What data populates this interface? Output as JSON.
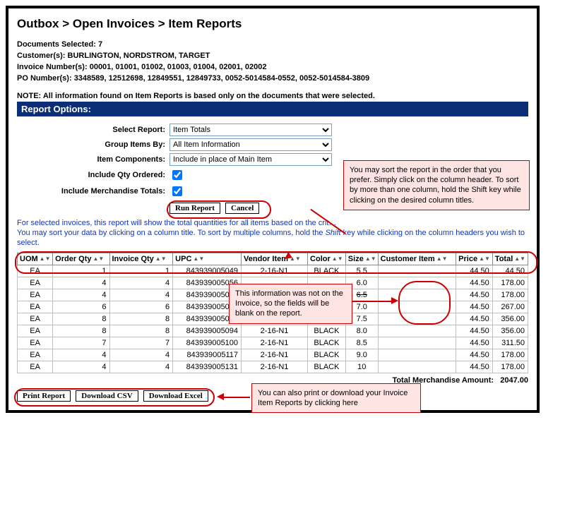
{
  "breadcrumb": "Outbox > Open Invoices > Item Reports",
  "summary": {
    "docs_selected_label": "Documents Selected:",
    "docs_selected": "7",
    "customer_label": "Customer(s):",
    "customers": "BURLINGTON, NORDSTROM, TARGET",
    "invoice_label": "Invoice Number(s):",
    "invoices": "00001, 01001, 01002, 01003, 01004, 02001, 02002",
    "po_label": "PO Number(s):",
    "pos": "3348589, 12512698, 12849551, 12849733, 0052-5014584-0552, 0052-5014584-3809"
  },
  "note": "NOTE: All information found on Item Reports is based only on the documents that were selected.",
  "section_header": "Report Options:",
  "form": {
    "select_report_label": "Select Report:",
    "select_report_value": "Item Totals",
    "group_label": "Group Items By:",
    "group_value": "All Item Information",
    "components_label": "Item Components:",
    "components_value": "Include in place of Main Item",
    "include_qty_label": "Include Qty Ordered:",
    "include_merch_label": "Include Merchandise Totals:",
    "run_button": "Run Report",
    "cancel_button": "Cancel"
  },
  "help1": "For selected invoices, this report will show the total quantities for all items based on the crit…",
  "help2a": "You may sort your data by clicking on a column title. To sort by multiple columns, hold the ",
  "help2i": "Shift",
  "help2b": " key while clicking on the column headers you wish to select.",
  "columns": [
    "UOM",
    "Order Qty",
    "Invoice Qty",
    "UPC",
    "Vendor Item",
    "Color",
    "Size",
    "Customer Item",
    "Price",
    "Total"
  ],
  "rows": [
    {
      "uom": "EA",
      "oq": "1",
      "iq": "1",
      "upc": "843939005049",
      "vi": "2-16-N1",
      "color": "BLACK",
      "size": "5.5",
      "ci": "",
      "price": "44.50",
      "total": "44.50"
    },
    {
      "uom": "EA",
      "oq": "4",
      "iq": "4",
      "upc": "843939005056",
      "vi": "",
      "color": "",
      "size": "6.0",
      "ci": "",
      "price": "44.50",
      "total": "178.00"
    },
    {
      "uom": "EA",
      "oq": "4",
      "iq": "4",
      "upc": "843939005063",
      "vi": "",
      "color": "",
      "size": "6.5",
      "ci": "",
      "price": "44.50",
      "total": "178.00",
      "strike": true
    },
    {
      "uom": "EA",
      "oq": "6",
      "iq": "6",
      "upc": "843939005070",
      "vi": "",
      "color": "",
      "size": "7.0",
      "ci": "",
      "price": "44.50",
      "total": "267.00"
    },
    {
      "uom": "EA",
      "oq": "8",
      "iq": "8",
      "upc": "843939005087",
      "vi": "",
      "color": "",
      "size": "7.5",
      "ci": "",
      "price": "44.50",
      "total": "356.00"
    },
    {
      "uom": "EA",
      "oq": "8",
      "iq": "8",
      "upc": "843939005094",
      "vi": "2-16-N1",
      "color": "BLACK",
      "size": "8.0",
      "ci": "",
      "price": "44.50",
      "total": "356.00"
    },
    {
      "uom": "EA",
      "oq": "7",
      "iq": "7",
      "upc": "843939005100",
      "vi": "2-16-N1",
      "color": "BLACK",
      "size": "8.5",
      "ci": "",
      "price": "44.50",
      "total": "311.50"
    },
    {
      "uom": "EA",
      "oq": "4",
      "iq": "4",
      "upc": "843939005117",
      "vi": "2-16-N1",
      "color": "BLACK",
      "size": "9.0",
      "ci": "",
      "price": "44.50",
      "total": "178.00"
    },
    {
      "uom": "EA",
      "oq": "4",
      "iq": "4",
      "upc": "843939005131",
      "vi": "2-16-N1",
      "color": "BLACK",
      "size": "10",
      "ci": "",
      "price": "44.50",
      "total": "178.00"
    }
  ],
  "total_label": "Total Merchandise Amount:",
  "total_value": "2047.00",
  "footer": {
    "print": "Print Report",
    "csv": "Download CSV",
    "excel": "Download Excel"
  },
  "callouts": {
    "sort": "You may sort the report in the order that you prefer. Simply click on the column header. To sort by more than one column, hold the Shift key while clicking on the desired column titles.",
    "blank": "This information was not on the Invoice, so the fields will be blank on the report.",
    "download": "You can also print or download your Invoice Item Reports by clicking here"
  }
}
